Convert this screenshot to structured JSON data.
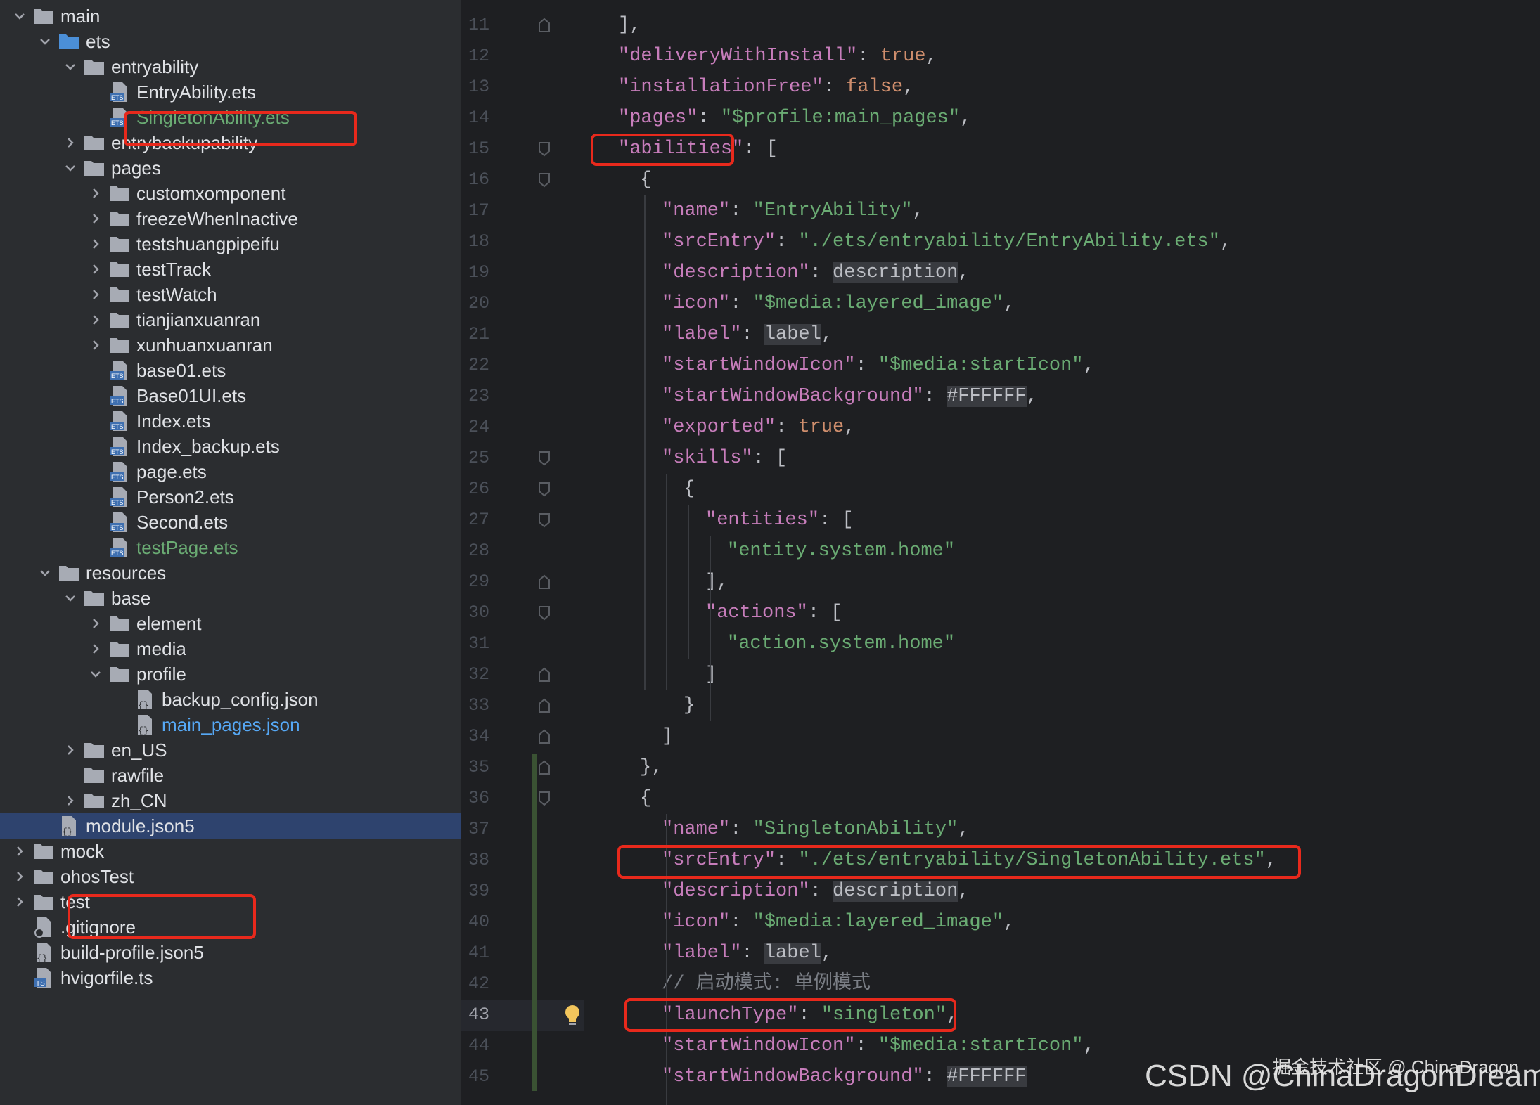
{
  "tree": {
    "items": [
      {
        "label": "main",
        "kind": "folder",
        "depth": 1,
        "expanded": true
      },
      {
        "label": "ets",
        "kind": "folder-blue",
        "depth": 2,
        "expanded": true
      },
      {
        "label": "entryability",
        "kind": "folder",
        "depth": 3,
        "expanded": true
      },
      {
        "label": "EntryAbility.ets",
        "kind": "ets",
        "depth": 4
      },
      {
        "label": "SingletonAbility.ets",
        "kind": "ets",
        "depth": 4,
        "color": "green"
      },
      {
        "label": "entrybackupability",
        "kind": "folder",
        "depth": 3,
        "expanded": false
      },
      {
        "label": "pages",
        "kind": "folder",
        "depth": 3,
        "expanded": true
      },
      {
        "label": "customxomponent",
        "kind": "folder",
        "depth": 4,
        "expanded": false
      },
      {
        "label": "freezeWhenInactive",
        "kind": "folder",
        "depth": 4,
        "expanded": false
      },
      {
        "label": "testshuangpipeifu",
        "kind": "folder",
        "depth": 4,
        "expanded": false
      },
      {
        "label": "testTrack",
        "kind": "folder",
        "depth": 4,
        "expanded": false
      },
      {
        "label": "testWatch",
        "kind": "folder",
        "depth": 4,
        "expanded": false
      },
      {
        "label": "tianjianxuanran",
        "kind": "folder",
        "depth": 4,
        "expanded": false
      },
      {
        "label": "xunhuanxuanran",
        "kind": "folder",
        "depth": 4,
        "expanded": false
      },
      {
        "label": "base01.ets",
        "kind": "ets",
        "depth": 4
      },
      {
        "label": "Base01UI.ets",
        "kind": "ets",
        "depth": 4
      },
      {
        "label": "Index.ets",
        "kind": "ets",
        "depth": 4
      },
      {
        "label": "Index_backup.ets",
        "kind": "ets",
        "depth": 4
      },
      {
        "label": "page.ets",
        "kind": "ets",
        "depth": 4
      },
      {
        "label": "Person2.ets",
        "kind": "ets",
        "depth": 4
      },
      {
        "label": "Second.ets",
        "kind": "ets",
        "depth": 4
      },
      {
        "label": "testPage.ets",
        "kind": "ets",
        "depth": 4,
        "color": "green"
      },
      {
        "label": "resources",
        "kind": "folder",
        "depth": 2,
        "expanded": true
      },
      {
        "label": "base",
        "kind": "folder",
        "depth": 3,
        "expanded": true
      },
      {
        "label": "element",
        "kind": "folder",
        "depth": 4,
        "expanded": false
      },
      {
        "label": "media",
        "kind": "folder",
        "depth": 4,
        "expanded": false
      },
      {
        "label": "profile",
        "kind": "folder",
        "depth": 4,
        "expanded": true
      },
      {
        "label": "backup_config.json",
        "kind": "json",
        "depth": 5
      },
      {
        "label": "main_pages.json",
        "kind": "json",
        "depth": 5,
        "color": "blue"
      },
      {
        "label": "en_US",
        "kind": "folder",
        "depth": 3,
        "expanded": false
      },
      {
        "label": "rawfile",
        "kind": "folder",
        "depth": 3,
        "nochev": true
      },
      {
        "label": "zh_CN",
        "kind": "folder",
        "depth": 3,
        "expanded": false
      },
      {
        "label": "module.json5",
        "kind": "json",
        "depth": 2,
        "selected": true
      },
      {
        "label": "mock",
        "kind": "folder",
        "depth": 1,
        "expanded": false
      },
      {
        "label": "ohosTest",
        "kind": "folder",
        "depth": 1,
        "expanded": false
      },
      {
        "label": "test",
        "kind": "folder",
        "depth": 1,
        "expanded": false
      },
      {
        "label": ".gitignore",
        "kind": "gitignore",
        "depth": 1,
        "nochev": true
      },
      {
        "label": "build-profile.json5",
        "kind": "json",
        "depth": 1,
        "nochev": true
      },
      {
        "label": "hvigorfile.ts",
        "kind": "ts",
        "depth": 1,
        "nochev": true
      }
    ]
  },
  "editor": {
    "current_line": "43",
    "lines": [
      {
        "n": "11",
        "indent": 1,
        "tokens": [
          [
            "p",
            "],"
          ]
        ]
      },
      {
        "n": "12",
        "indent": 1,
        "tokens": [
          [
            "k",
            "\"deliveryWithInstall\""
          ],
          [
            "p",
            ": "
          ],
          [
            "b",
            "true"
          ],
          [
            "p",
            ","
          ]
        ]
      },
      {
        "n": "13",
        "indent": 1,
        "tokens": [
          [
            "k",
            "\"installationFree\""
          ],
          [
            "p",
            ": "
          ],
          [
            "b",
            "false"
          ],
          [
            "p",
            ","
          ]
        ]
      },
      {
        "n": "14",
        "indent": 1,
        "tokens": [
          [
            "k",
            "\"pages\""
          ],
          [
            "p",
            ": "
          ],
          [
            "s",
            "\"$profile:main_pages\""
          ],
          [
            "p",
            ","
          ]
        ]
      },
      {
        "n": "15",
        "indent": 1,
        "tokens": [
          [
            "k",
            "\"abilities\""
          ],
          [
            "p",
            ": ["
          ]
        ]
      },
      {
        "n": "16",
        "indent": 2,
        "tokens": [
          [
            "p",
            "{"
          ]
        ]
      },
      {
        "n": "17",
        "indent": 3,
        "tokens": [
          [
            "k",
            "\"name\""
          ],
          [
            "p",
            ": "
          ],
          [
            "s",
            "\"EntryAbility\""
          ],
          [
            "p",
            ","
          ]
        ]
      },
      {
        "n": "18",
        "indent": 3,
        "tokens": [
          [
            "k",
            "\"srcEntry\""
          ],
          [
            "p",
            ": "
          ],
          [
            "s",
            "\"./ets/entryability/EntryAbility.ets\""
          ],
          [
            "p",
            ","
          ]
        ]
      },
      {
        "n": "19",
        "indent": 3,
        "tokens": [
          [
            "k",
            "\"description\""
          ],
          [
            "p",
            ": "
          ],
          [
            "hl",
            "description"
          ],
          [
            "p",
            ","
          ]
        ]
      },
      {
        "n": "20",
        "indent": 3,
        "tokens": [
          [
            "k",
            "\"icon\""
          ],
          [
            "p",
            ": "
          ],
          [
            "s",
            "\"$media:layered_image\""
          ],
          [
            "p",
            ","
          ]
        ]
      },
      {
        "n": "21",
        "indent": 3,
        "tokens": [
          [
            "k",
            "\"label\""
          ],
          [
            "p",
            ": "
          ],
          [
            "hl",
            "label"
          ],
          [
            "p",
            ","
          ]
        ]
      },
      {
        "n": "22",
        "indent": 3,
        "tokens": [
          [
            "k",
            "\"startWindowIcon\""
          ],
          [
            "p",
            ": "
          ],
          [
            "s",
            "\"$media:startIcon\""
          ],
          [
            "p",
            ","
          ]
        ]
      },
      {
        "n": "23",
        "indent": 3,
        "tokens": [
          [
            "k",
            "\"startWindowBackground\""
          ],
          [
            "p",
            ": "
          ],
          [
            "hl",
            "#FFFFFF"
          ],
          [
            "p",
            ","
          ]
        ]
      },
      {
        "n": "24",
        "indent": 3,
        "tokens": [
          [
            "k",
            "\"exported\""
          ],
          [
            "p",
            ": "
          ],
          [
            "b",
            "true"
          ],
          [
            "p",
            ","
          ]
        ]
      },
      {
        "n": "25",
        "indent": 3,
        "tokens": [
          [
            "k",
            "\"skills\""
          ],
          [
            "p",
            ": ["
          ]
        ]
      },
      {
        "n": "26",
        "indent": 4,
        "tokens": [
          [
            "p",
            "{"
          ]
        ]
      },
      {
        "n": "27",
        "indent": 5,
        "tokens": [
          [
            "k",
            "\"entities\""
          ],
          [
            "p",
            ": ["
          ]
        ]
      },
      {
        "n": "28",
        "indent": 6,
        "tokens": [
          [
            "s",
            "\"entity.system.home\""
          ]
        ]
      },
      {
        "n": "29",
        "indent": 5,
        "tokens": [
          [
            "p",
            "],"
          ]
        ]
      },
      {
        "n": "30",
        "indent": 5,
        "tokens": [
          [
            "k",
            "\"actions\""
          ],
          [
            "p",
            ": ["
          ]
        ]
      },
      {
        "n": "31",
        "indent": 6,
        "tokens": [
          [
            "s",
            "\"action.system.home\""
          ]
        ]
      },
      {
        "n": "32",
        "indent": 5,
        "tokens": [
          [
            "p",
            "]"
          ]
        ]
      },
      {
        "n": "33",
        "indent": 4,
        "tokens": [
          [
            "p",
            "}"
          ]
        ]
      },
      {
        "n": "34",
        "indent": 3,
        "tokens": [
          [
            "p",
            "]"
          ]
        ]
      },
      {
        "n": "35",
        "indent": 2,
        "tokens": [
          [
            "p",
            "},"
          ]
        ]
      },
      {
        "n": "36",
        "indent": 2,
        "tokens": [
          [
            "p",
            "{"
          ]
        ]
      },
      {
        "n": "37",
        "indent": 3,
        "tokens": [
          [
            "k",
            "\"name\""
          ],
          [
            "p",
            ": "
          ],
          [
            "s",
            "\"SingletonAbility\""
          ],
          [
            "p",
            ","
          ]
        ]
      },
      {
        "n": "38",
        "indent": 3,
        "tokens": [
          [
            "k",
            "\"srcEntry\""
          ],
          [
            "p",
            ": "
          ],
          [
            "s",
            "\"./ets/entryability/SingletonAbility.ets\""
          ],
          [
            "p",
            ","
          ]
        ]
      },
      {
        "n": "39",
        "indent": 3,
        "tokens": [
          [
            "k",
            "\"description\""
          ],
          [
            "p",
            ": "
          ],
          [
            "hl",
            "description"
          ],
          [
            "p",
            ","
          ]
        ]
      },
      {
        "n": "40",
        "indent": 3,
        "tokens": [
          [
            "k",
            "\"icon\""
          ],
          [
            "p",
            ": "
          ],
          [
            "s",
            "\"$media:layered_image\""
          ],
          [
            "p",
            ","
          ]
        ]
      },
      {
        "n": "41",
        "indent": 3,
        "tokens": [
          [
            "k",
            "\"label\""
          ],
          [
            "p",
            ": "
          ],
          [
            "hl",
            "label"
          ],
          [
            "p",
            ","
          ]
        ]
      },
      {
        "n": "42",
        "indent": 3,
        "tokens": [
          [
            "cm",
            "// 启动模式: 单例模式"
          ]
        ]
      },
      {
        "n": "43",
        "indent": 3,
        "tokens": [
          [
            "k",
            "\"launchType\""
          ],
          [
            "p",
            ": "
          ],
          [
            "s",
            "\"singleton\""
          ],
          [
            "p",
            ","
          ]
        ]
      },
      {
        "n": "44",
        "indent": 3,
        "tokens": [
          [
            "k",
            "\"startWindowIcon\""
          ],
          [
            "p",
            ": "
          ],
          [
            "s",
            "\"$media:startIcon\""
          ],
          [
            "p",
            ","
          ]
        ]
      },
      {
        "n": "45",
        "indent": 3,
        "tokens": [
          [
            "k",
            "\"startWindowBackground\""
          ],
          [
            "p",
            ": "
          ],
          [
            "hl",
            "#FFFFFF"
          ]
        ]
      }
    ]
  },
  "watermark": {
    "top": "掘金技术社区 @ ChinaDragon",
    "bottom": "CSDN @ChinaDragonDreamer"
  },
  "colors": {
    "annotation_red": "#e8291c",
    "selection_blue": "#2e436e",
    "string_green": "#6aab73",
    "keyword_purple": "#c77dbb",
    "boolean_orange": "#cf8e6d"
  }
}
